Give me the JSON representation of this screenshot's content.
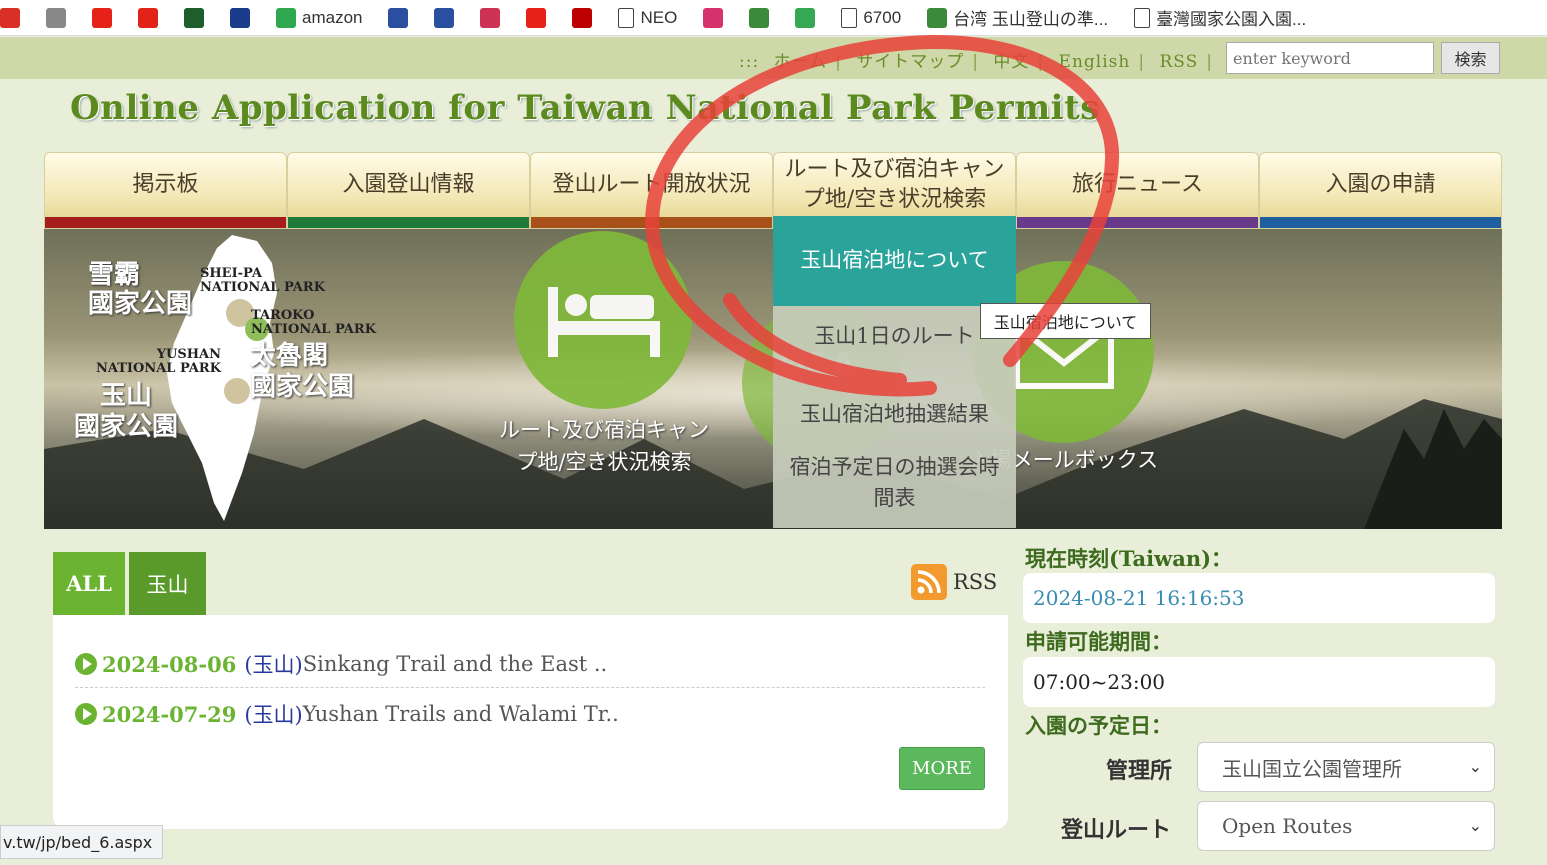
{
  "bookmarks": [
    {
      "label": "",
      "icon": "gmail-icon",
      "color": "#d93025"
    },
    {
      "label": "",
      "icon": "apple-icon",
      "color": "#888888"
    },
    {
      "label": "",
      "icon": "youtube-icon",
      "color": "#e62117"
    },
    {
      "label": "",
      "icon": "adobe-icon",
      "color": "#e2231a"
    },
    {
      "label": "",
      "icon": "leaf-book-icon",
      "color": "#1d5e2a"
    },
    {
      "label": "",
      "icon": "bookmark-square-icon",
      "color": "#1a3a8a"
    },
    {
      "label": "amazon",
      "icon": "amazon-icon",
      "color": "#2fa84f"
    },
    {
      "label": "",
      "icon": "figure-icon",
      "color": "#2a4ea0"
    },
    {
      "label": "",
      "icon": "figure-icon",
      "color": "#2a4ea0"
    },
    {
      "label": "",
      "icon": "mail-icon",
      "color": "#cc3355"
    },
    {
      "label": "",
      "icon": "youtube-icon",
      "color": "#e62117"
    },
    {
      "label": "",
      "icon": "rakuten-icon",
      "color": "#bf0000"
    },
    {
      "label": "NEO",
      "icon": "page-icon",
      "color": "#ffffff"
    },
    {
      "label": "",
      "icon": "instagram-icon",
      "color": "#d6336c"
    },
    {
      "label": "",
      "icon": "mountain-icon",
      "color": "#3a8a3a"
    },
    {
      "label": "",
      "icon": "maps-icon",
      "color": "#34a853"
    },
    {
      "label": "6700",
      "icon": "page-icon",
      "color": "#ffffff"
    },
    {
      "label": "台湾 玉山登山の準...",
      "icon": "mountain-icon",
      "color": "#3a8a3a"
    },
    {
      "label": "臺灣國家公園入園...",
      "icon": "page-icon",
      "color": "#ffffff"
    }
  ],
  "util": {
    "prefix": ":::",
    "links": [
      "ホーム",
      "サイトマップ",
      "中文",
      "English",
      "RSS"
    ],
    "search_placeholder": "enter keyword",
    "search_button": "検索"
  },
  "site_title": "Online Application for Taiwan National Park Permits",
  "nav": [
    {
      "label": "掲示板",
      "bar": "#a51d1d"
    },
    {
      "label": "入園登山情報",
      "bar": "#1f7a3a"
    },
    {
      "label": "登山ルート開放状況",
      "bar": "#a8501a"
    },
    {
      "label": "ルート及び宿泊キャンプ地/空き状況検索",
      "bar": "#2aa39a"
    },
    {
      "label": "旅行ニュース",
      "bar": "#6a3a8a"
    },
    {
      "label": "入園の申請",
      "bar": "#1f5fa0"
    }
  ],
  "banner": {
    "map_labels": {
      "sheipa_zh": "雪霸\n國家公園",
      "sheipa_en": "SHEI-PA\nNATIONAL PARK",
      "taroko_en": "TAROKO\nNATIONAL PARK",
      "taroko_zh": "太魯閣\n國家公園",
      "yushan_en": "YUSHAN\nNATIONAL PARK",
      "yushan_zh": "玉山\n國家公園"
    },
    "captions": {
      "lodging": "ルート及び宿泊キャン\nプ地/空き状況検索",
      "mailbox": "入場メールボックス"
    }
  },
  "dropdown": [
    {
      "label": "玉山宿泊地について",
      "active": true
    },
    {
      "label": "玉山1日のルート",
      "active": false
    },
    {
      "label": "玉山宿泊地抽選結果",
      "active": false
    },
    {
      "label": "宿泊予定日の抽選会時間表",
      "active": false
    }
  ],
  "tooltip": "玉山宿泊地について",
  "news": {
    "tabs": [
      "ALL",
      "玉山"
    ],
    "rss_label": "RSS",
    "items": [
      {
        "date": "2024-08-06",
        "tag": "(玉山)",
        "title": "Sinkang Trail and the East .."
      },
      {
        "date": "2024-07-29",
        "tag": "(玉山)",
        "title": "Yushan Trails and Walami Tr.."
      }
    ],
    "more_label": "MORE"
  },
  "right_panel": {
    "time_label": "現在時刻(Taiwan)：",
    "time_value": "2024-08-21 16:16:53",
    "period_label": "申請可能期間：",
    "period_value": "07:00~23:00",
    "date_label": "入園の予定日：",
    "office_label": "管理所",
    "office_value": "玉山国立公園管理所",
    "route_label": "登山ルート",
    "route_value": "Open Routes"
  },
  "status_url": "v.tw/jp/bed_6.aspx"
}
